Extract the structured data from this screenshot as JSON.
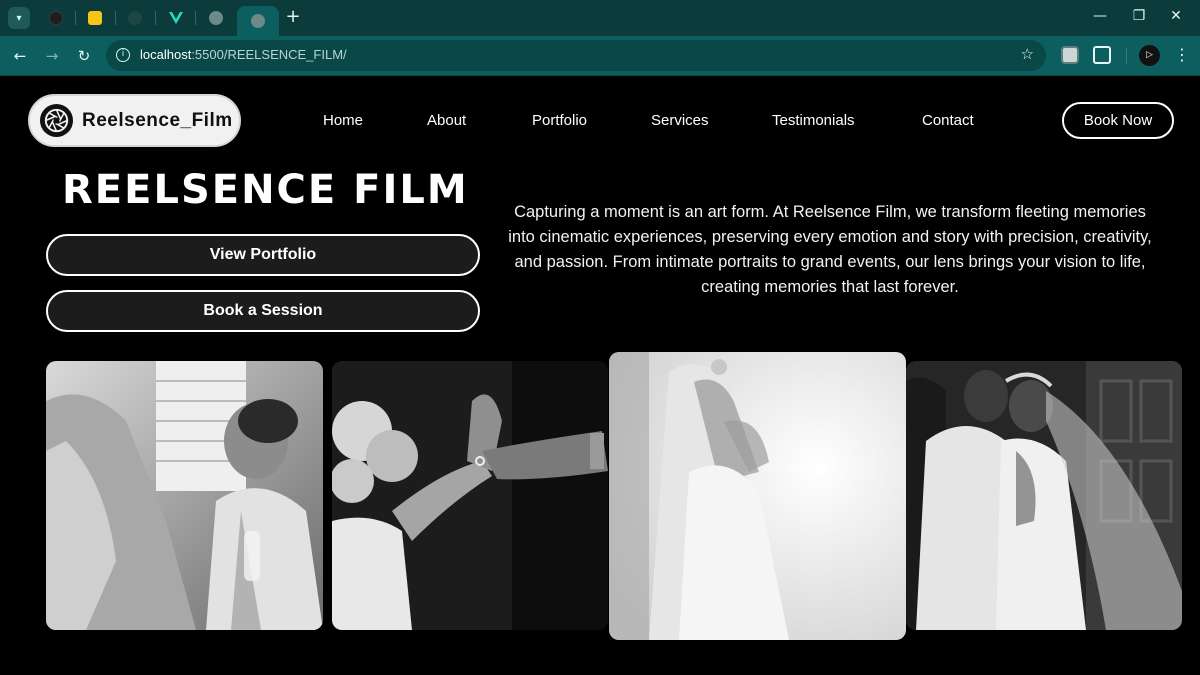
{
  "browser": {
    "tabs": [
      {
        "name": "tab-1",
        "color": "#1e1e1e"
      },
      {
        "name": "tab-2",
        "color": "#f5c518"
      },
      {
        "name": "tab-3",
        "color": "#24292f"
      },
      {
        "name": "tab-4",
        "color": "#2bd9c4"
      },
      {
        "name": "tab-5",
        "color": "#6b8a8a"
      },
      {
        "name": "tab-6",
        "color": "#6b8a8a"
      }
    ],
    "new_tab_glyph": "+",
    "window_controls": {
      "minimize": "—",
      "restore": "❐",
      "close": "✕"
    },
    "url_host": "localhost",
    "url_path": ":5500/REELSENCE_FILM/",
    "back_glyph": "←",
    "forward_glyph": "→",
    "reload_glyph": "↻",
    "star_glyph": "☆",
    "profile_label": "▷"
  },
  "header": {
    "logo_text": "Reelsence_Film",
    "nav": [
      "Home",
      "About",
      "Portfolio",
      "Services",
      "Testimonials",
      "Contact"
    ],
    "cta": "Book Now"
  },
  "hero": {
    "title": "REELSENCE FILM",
    "buttons": [
      "View Portfolio",
      "Book a Session"
    ],
    "description": "Capturing a moment is an art form. At Reelsence Film, we transform fleeting memories into cinematic experiences, preserving every emotion and story with precision, creativity, and passion. From intimate portraits to grand events, our lens brings your vision to life, creating memories that last forever."
  },
  "gallery": {
    "photos": [
      {
        "name": "photo-bride-makeup"
      },
      {
        "name": "photo-ring-exchange"
      },
      {
        "name": "photo-bride-veil"
      },
      {
        "name": "photo-couple-embrace"
      }
    ]
  },
  "colors": {
    "chrome_dark": "#0b3b3b",
    "chrome_toolbar": "#0d5e5e",
    "page_bg": "#000000",
    "accent_white": "#ffffff"
  }
}
